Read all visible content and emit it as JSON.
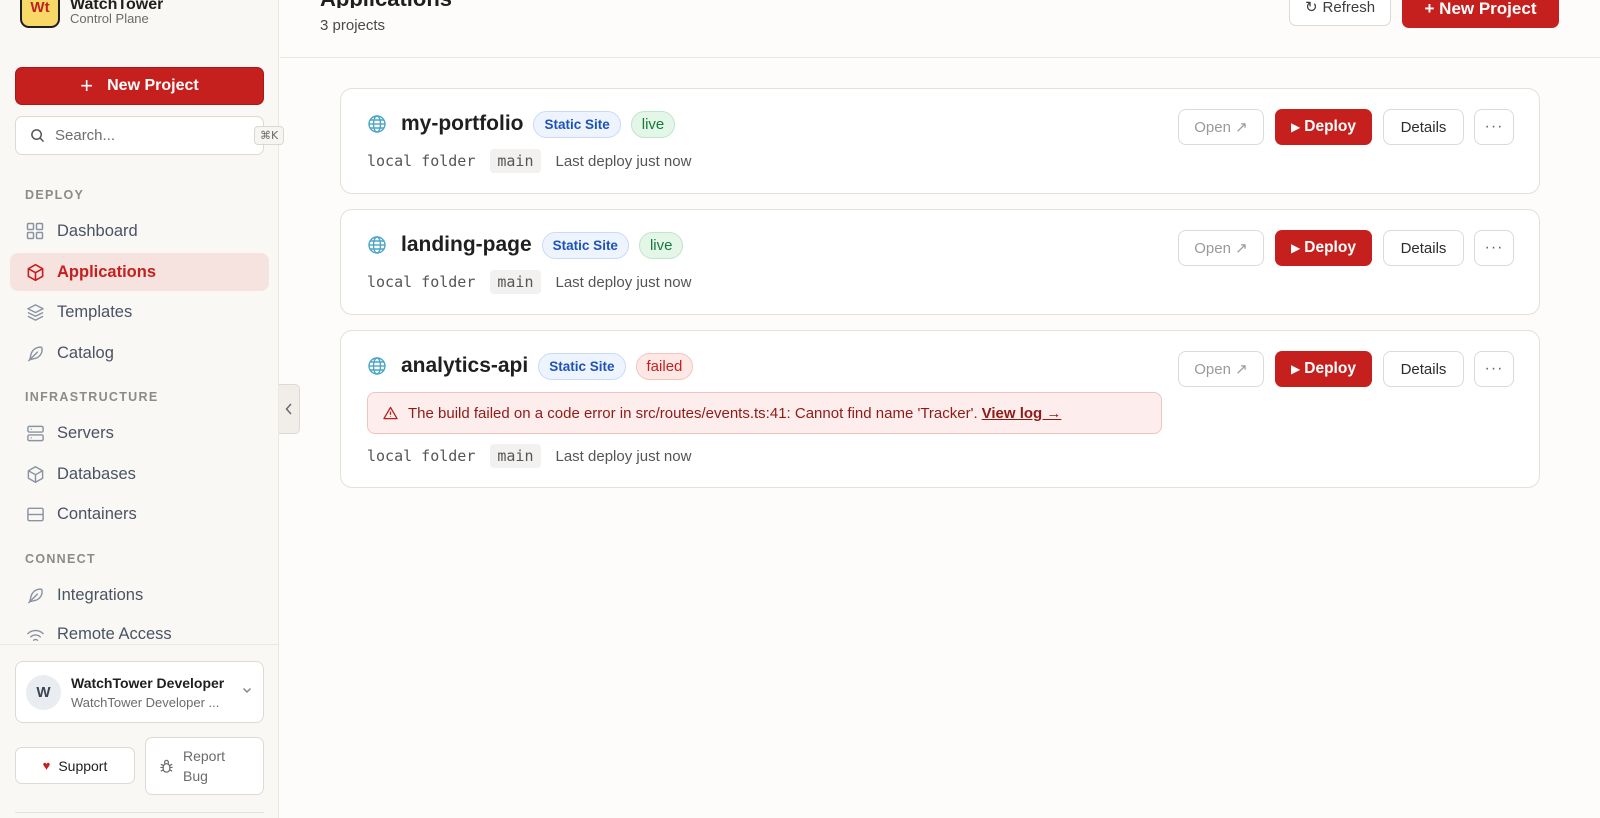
{
  "brand": {
    "name": "WatchTower",
    "subtitle": "Control Plane",
    "logo_text": "Wt"
  },
  "sidebar": {
    "new_project_label": "New Project",
    "search": {
      "placeholder": "Search...",
      "shortcut": "⌘K"
    },
    "sections": [
      {
        "label": "DEPLOY",
        "items": [
          {
            "label": "Dashboard",
            "icon": "grid-icon"
          },
          {
            "label": "Applications",
            "icon": "cube-icon",
            "active": true
          },
          {
            "label": "Templates",
            "icon": "layers-icon"
          },
          {
            "label": "Catalog",
            "icon": "feather-icon"
          }
        ]
      },
      {
        "label": "INFRASTRUCTURE",
        "items": [
          {
            "label": "Servers",
            "icon": "server-icon"
          },
          {
            "label": "Databases",
            "icon": "box-icon"
          },
          {
            "label": "Containers",
            "icon": "container-icon"
          }
        ]
      },
      {
        "label": "CONNECT",
        "items": [
          {
            "label": "Integrations",
            "icon": "feather-icon"
          },
          {
            "label": "Remote Access",
            "icon": "wifi-icon"
          }
        ]
      }
    ],
    "user": {
      "initial": "W",
      "name": "WatchTower Developer",
      "subtitle": "WatchTower Developer ..."
    },
    "support_label": "Support",
    "report_bug_label": "Report Bug"
  },
  "header": {
    "title": "Applications",
    "subtitle": "3 projects",
    "refresh_label": "Refresh",
    "new_project_label": "+ New Project"
  },
  "project_actions": {
    "open": "Open",
    "deploy": "Deploy",
    "details": "Details",
    "more": "···"
  },
  "projects": [
    {
      "name": "my-portfolio",
      "type": "Static Site",
      "status": "live",
      "source": "local folder",
      "branch": "main",
      "last_deploy": "Last deploy just now"
    },
    {
      "name": "landing-page",
      "type": "Static Site",
      "status": "live",
      "source": "local folder",
      "branch": "main",
      "last_deploy": "Last deploy just now"
    },
    {
      "name": "analytics-api",
      "type": "Static Site",
      "status": "failed",
      "source": "local folder",
      "branch": "main",
      "last_deploy": "Last deploy just now",
      "error": {
        "message": "The build failed on a code error in src/routes/events.ts:41: Cannot find name 'Tracker'.",
        "link": "View log →"
      }
    }
  ],
  "colors": {
    "accent": "#c5201e",
    "live": "#157a3c",
    "failed": "#c5201e",
    "badge": "#1f52b8"
  }
}
